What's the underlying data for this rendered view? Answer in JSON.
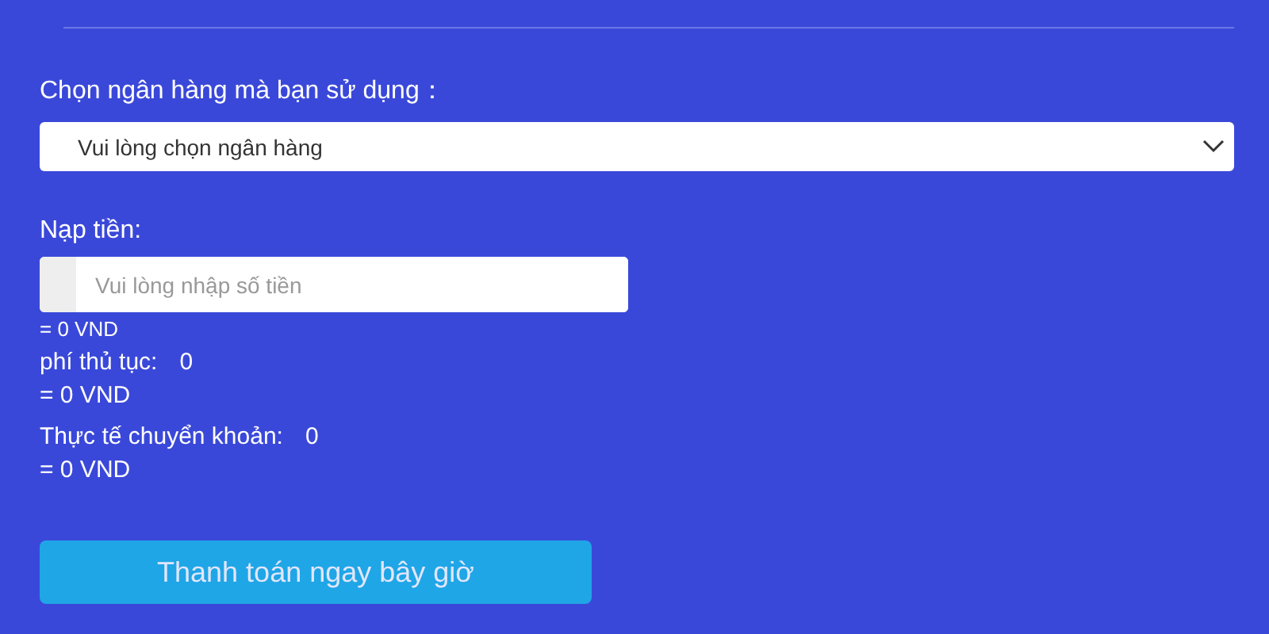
{
  "bank": {
    "label": "Chọn ngân hàng mà bạn sử dụng：",
    "placeholder": "Vui lòng chọn ngân hàng"
  },
  "deposit": {
    "label": "Nạp tiền:",
    "placeholder": "Vui lòng nhập số tiền",
    "converted": "= 0 VND"
  },
  "summary": [
    {
      "label": "phí thủ tục:",
      "value": "0",
      "converted": "= 0 VND"
    },
    {
      "label": "Thực tế chuyển khoản:",
      "value": "0",
      "converted": "= 0 VND"
    }
  ],
  "submit": {
    "label": "Thanh toán ngay bây giờ",
    "disabled": true
  }
}
